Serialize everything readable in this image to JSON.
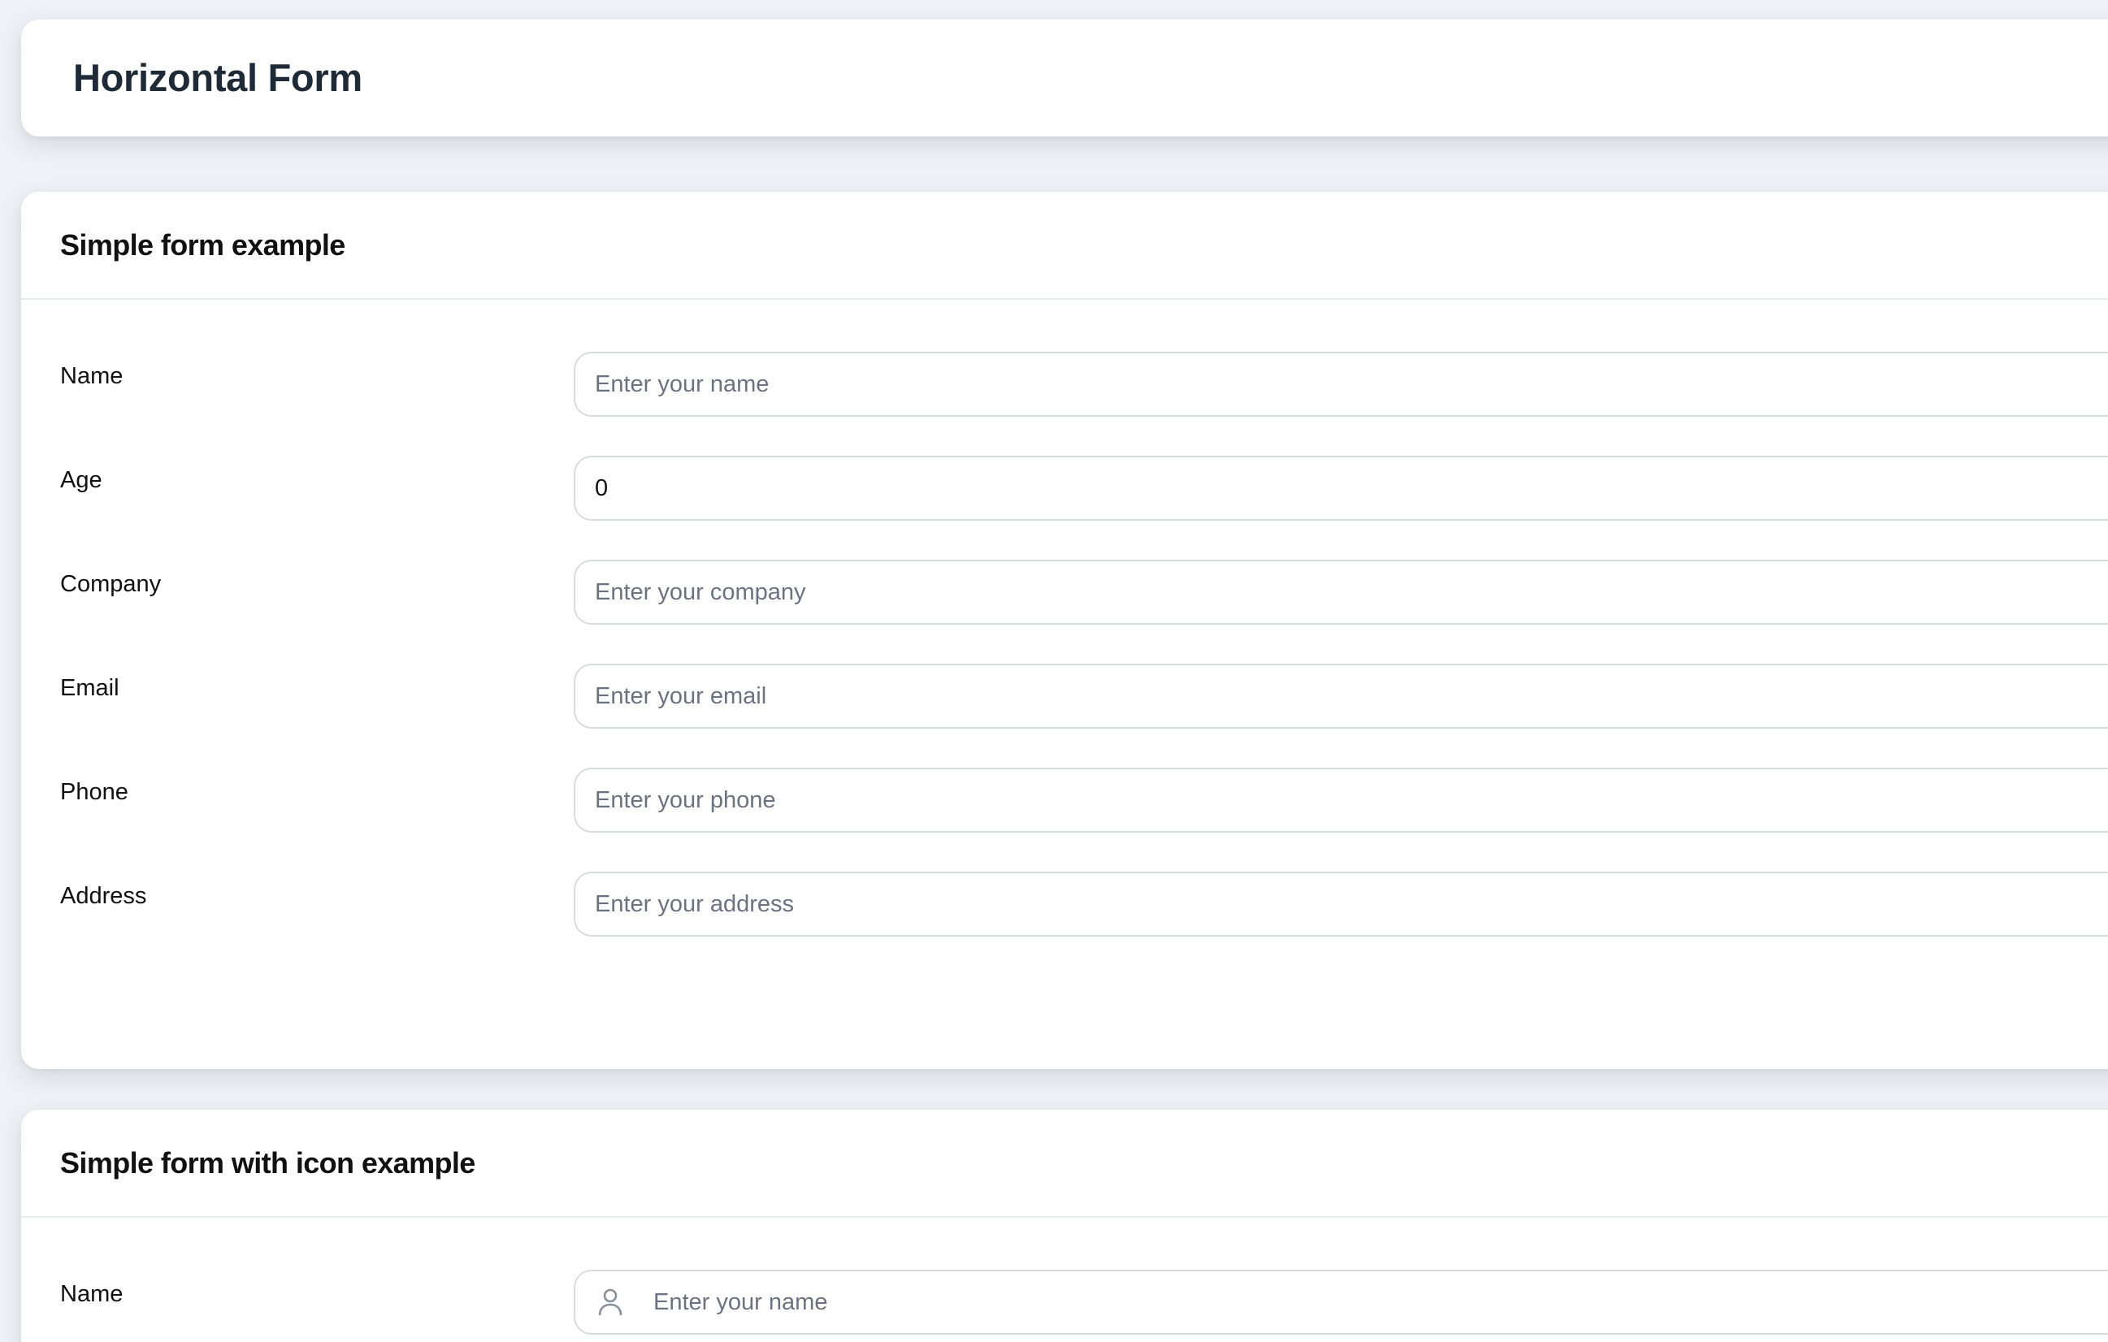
{
  "page": {
    "title": "Horizontal Form"
  },
  "simple_form": {
    "heading": "Simple form example",
    "fields": [
      {
        "label": "Name",
        "value": "",
        "placeholder": "Enter your name"
      },
      {
        "label": "Age",
        "value": "0",
        "placeholder": ""
      },
      {
        "label": "Company",
        "value": "",
        "placeholder": "Enter your company"
      },
      {
        "label": "Email",
        "value": "",
        "placeholder": "Enter your email"
      },
      {
        "label": "Phone",
        "value": "",
        "placeholder": "Enter your phone"
      },
      {
        "label": "Address",
        "value": "",
        "placeholder": "Enter your address"
      }
    ]
  },
  "icon_form": {
    "heading": "Simple form with icon example",
    "fields": [
      {
        "label": "Name",
        "value": "",
        "placeholder": "Enter your name",
        "icon": "user-icon"
      }
    ]
  },
  "colors": {
    "background": "#eef2f6",
    "card": "#ffffff",
    "input_border": "#d8dbe0",
    "placeholder": "#6b7280",
    "title": "#1f2a37"
  }
}
